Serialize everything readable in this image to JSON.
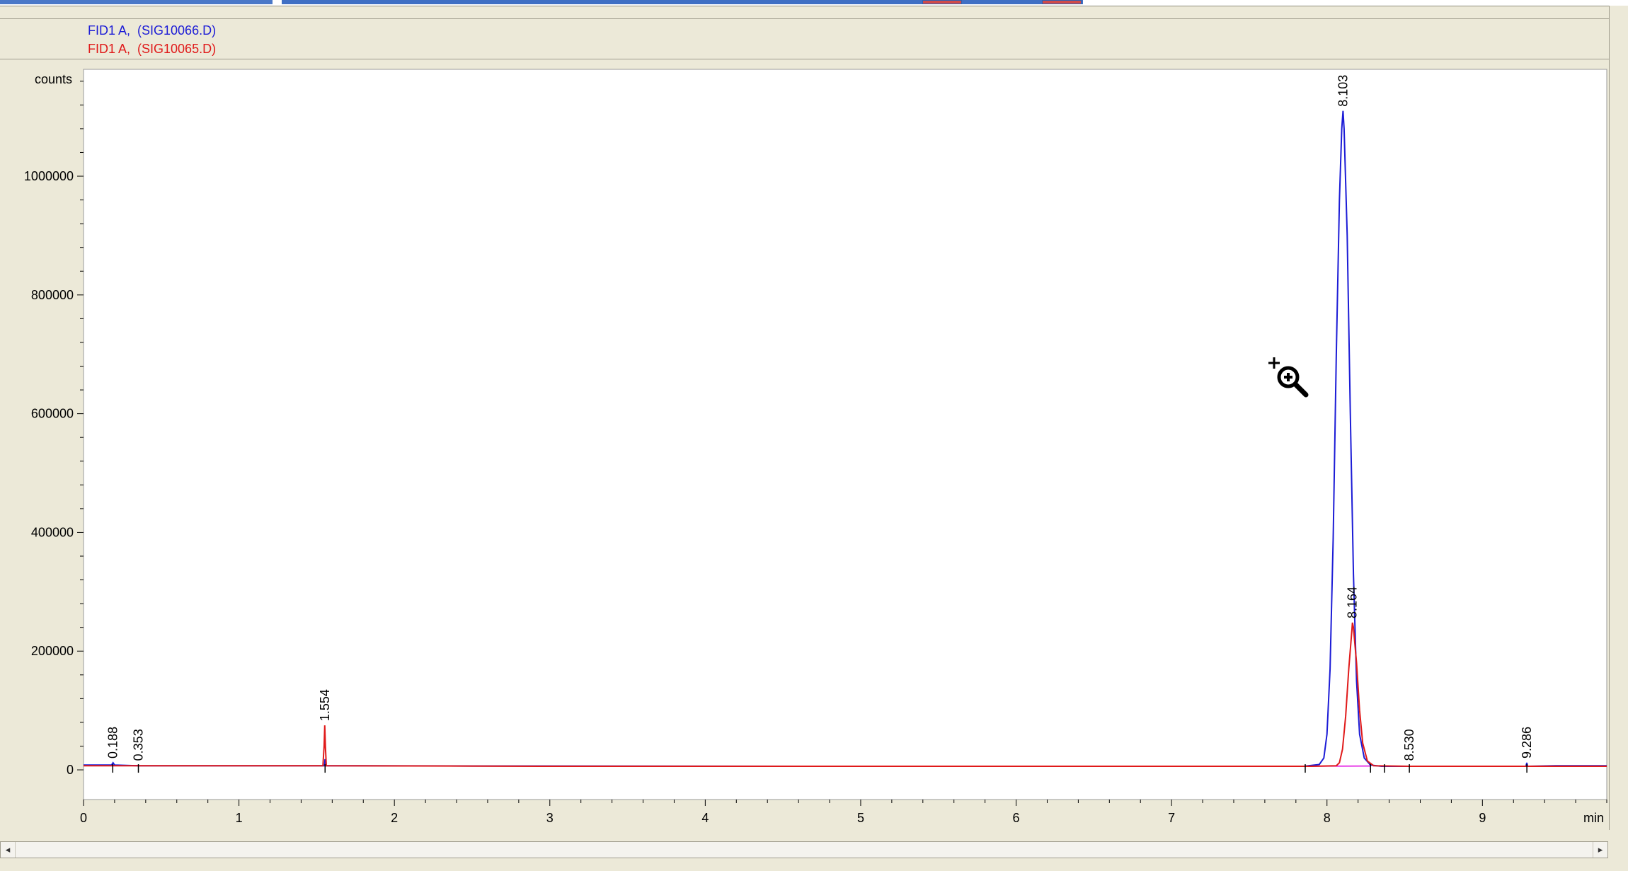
{
  "legend": {
    "entries": [
      {
        "label": "FID1 A,  (SIG10066.D)",
        "color": "#1c1cd6"
      },
      {
        "label": "FID1 A,  (SIG10065.D)",
        "color": "#e01a1a"
      }
    ]
  },
  "scrollbar": {
    "left_arrow": "◂",
    "right_arrow": "▸"
  },
  "cursor": {
    "icon": "zoom-in-magnifier-icon"
  },
  "chart_data": {
    "type": "line",
    "ylabel": "counts",
    "xlabel": "min",
    "x_ticks": [
      0,
      1,
      2,
      3,
      4,
      5,
      6,
      7,
      8,
      9
    ],
    "y_ticks": [
      0,
      200000,
      400000,
      600000,
      800000,
      1000000
    ],
    "xlim": [
      0,
      9.8
    ],
    "ylim": [
      -50000,
      1180000
    ],
    "grid": false,
    "legend_position": "top-left",
    "series": [
      {
        "name": "FID1 A,  (SIG10066.D)",
        "color": "#1c1cd6",
        "points": [
          [
            0,
            8000
          ],
          [
            0.18,
            8000
          ],
          [
            0.19,
            12000
          ],
          [
            0.2,
            8000
          ],
          [
            0.35,
            7000
          ],
          [
            1.0,
            7000
          ],
          [
            1.55,
            7000
          ],
          [
            1.554,
            18000
          ],
          [
            1.56,
            7000
          ],
          [
            2.5,
            6500
          ],
          [
            5.0,
            6000
          ],
          [
            7.85,
            6000
          ],
          [
            7.95,
            9000
          ],
          [
            7.98,
            20000
          ],
          [
            8.0,
            60000
          ],
          [
            8.02,
            170000
          ],
          [
            8.04,
            390000
          ],
          [
            8.06,
            700000
          ],
          [
            8.08,
            960000
          ],
          [
            8.095,
            1080000
          ],
          [
            8.103,
            1110000
          ],
          [
            8.11,
            1080000
          ],
          [
            8.13,
            900000
          ],
          [
            8.15,
            600000
          ],
          [
            8.17,
            330000
          ],
          [
            8.19,
            150000
          ],
          [
            8.21,
            60000
          ],
          [
            8.24,
            20000
          ],
          [
            8.28,
            8000
          ],
          [
            8.35,
            6000
          ],
          [
            9.28,
            6000
          ],
          [
            9.286,
            12000
          ],
          [
            9.29,
            6000
          ],
          [
            9.47,
            7000
          ],
          [
            9.6,
            7000
          ],
          [
            9.8,
            7000
          ]
        ]
      },
      {
        "name": "FID1 A,  (SIG10065.D)",
        "color": "#e01a1a",
        "points": [
          [
            0,
            7000
          ],
          [
            0.5,
            7000
          ],
          [
            1.54,
            7000
          ],
          [
            1.548,
            40000
          ],
          [
            1.552,
            75000
          ],
          [
            1.556,
            40000
          ],
          [
            1.562,
            7000
          ],
          [
            3.0,
            6000
          ],
          [
            7.9,
            6000
          ],
          [
            8.06,
            7000
          ],
          [
            8.08,
            12000
          ],
          [
            8.1,
            35000
          ],
          [
            8.12,
            90000
          ],
          [
            8.14,
            170000
          ],
          [
            8.16,
            235000
          ],
          [
            8.164,
            248000
          ],
          [
            8.17,
            240000
          ],
          [
            8.19,
            180000
          ],
          [
            8.21,
            100000
          ],
          [
            8.23,
            45000
          ],
          [
            8.26,
            15000
          ],
          [
            8.3,
            7000
          ],
          [
            8.53,
            6000
          ],
          [
            9.8,
            6000
          ]
        ]
      }
    ],
    "baseline_markers": [
      0.188,
      0.353,
      1.554,
      7.86,
      8.28,
      8.37,
      8.53,
      9.286
    ],
    "peak_labels": [
      {
        "x": 0.188,
        "y": 12000,
        "label": "0.188"
      },
      {
        "x": 0.353,
        "y": 8000,
        "label": "0.353"
      },
      {
        "x": 1.554,
        "y": 75000,
        "label": "1.554"
      },
      {
        "x": 8.103,
        "y": 1110000,
        "label": "8.103"
      },
      {
        "x": 8.164,
        "y": 248000,
        "label": "8.164"
      },
      {
        "x": 8.53,
        "y": 8000,
        "label": "8.530"
      },
      {
        "x": 9.286,
        "y": 12000,
        "label": "9.286"
      }
    ]
  }
}
